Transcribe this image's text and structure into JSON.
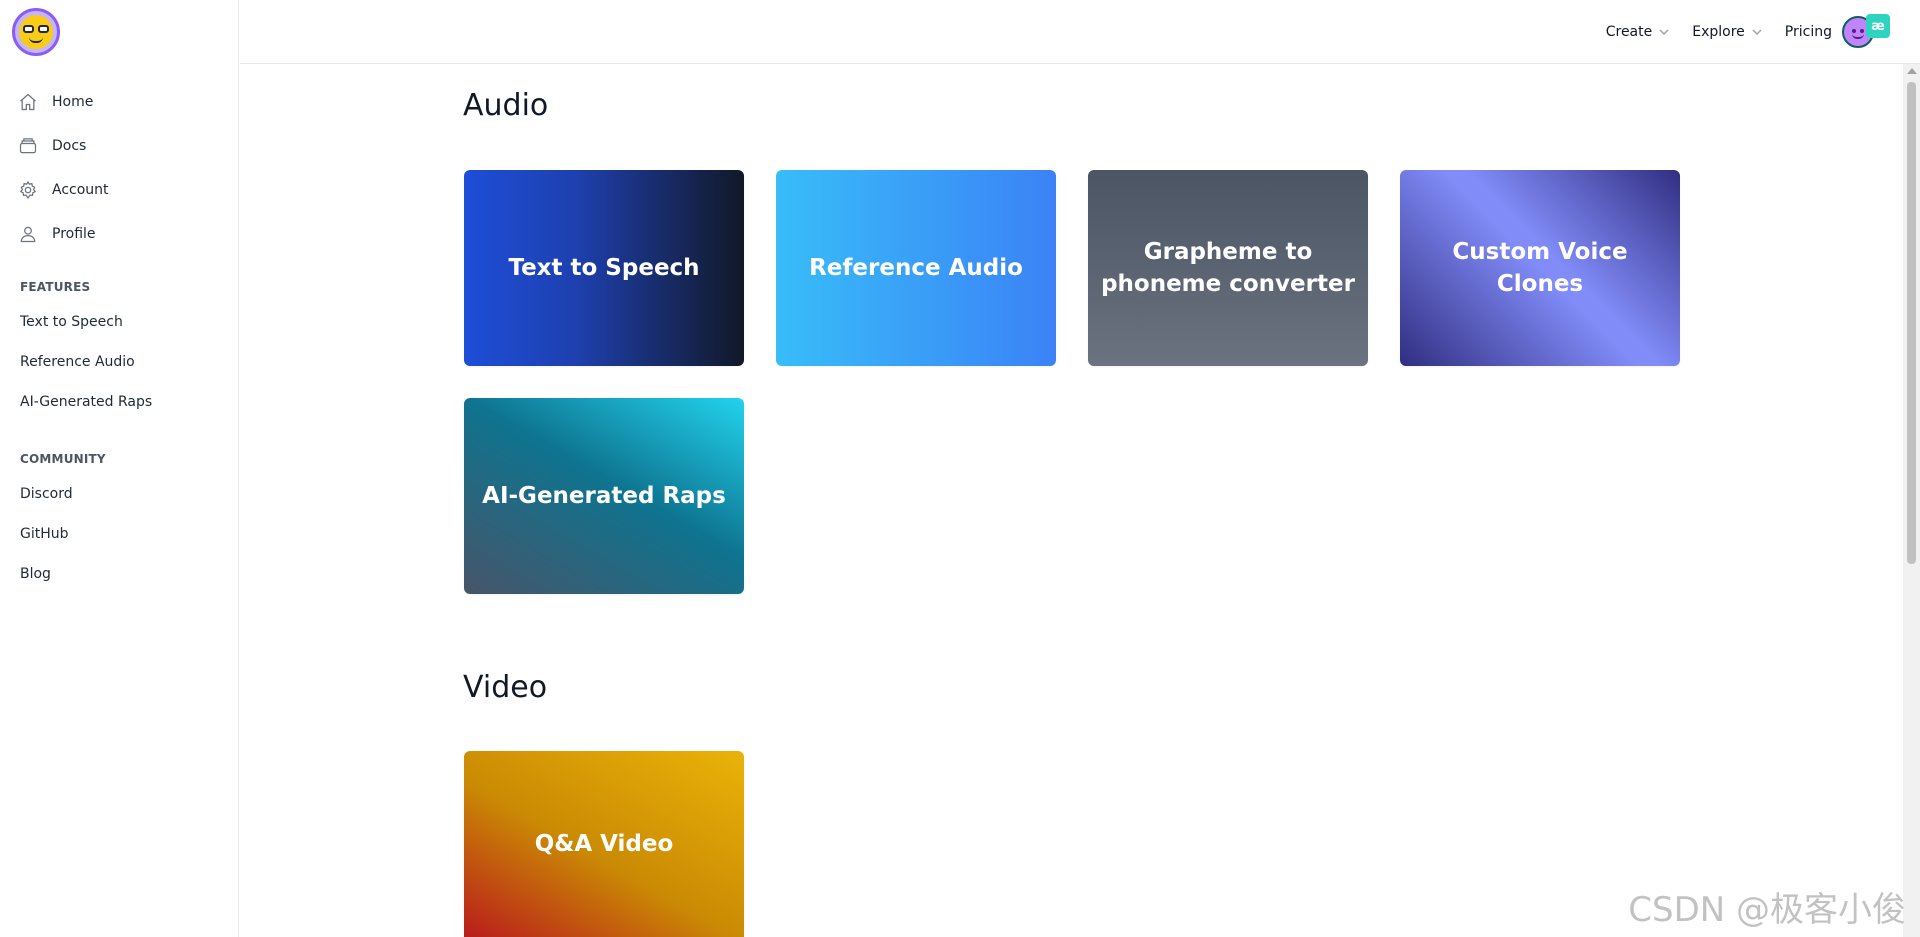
{
  "sidebar": {
    "main_items": [
      {
        "label": "Home",
        "icon": "home-icon"
      },
      {
        "label": "Docs",
        "icon": "docs-icon"
      },
      {
        "label": "Account",
        "icon": "gear-icon"
      },
      {
        "label": "Profile",
        "icon": "user-icon"
      }
    ],
    "features_title": "FEATURES",
    "features": [
      "Text to Speech",
      "Reference Audio",
      "AI-Generated Raps"
    ],
    "community_title": "COMMUNITY",
    "community": [
      "Discord",
      "GitHub",
      "Blog"
    ]
  },
  "header": {
    "create_label": "Create",
    "explore_label": "Explore",
    "pricing_label": "Pricing",
    "avatar_badge": "æ"
  },
  "main": {
    "audio_heading": "Audio",
    "audio_cards": [
      "Text to Speech",
      "Reference Audio",
      "Grapheme to phoneme converter",
      "Custom Voice Clones",
      "AI-Generated Raps"
    ],
    "video_heading": "Video",
    "video_cards": [
      "Q&A Video"
    ]
  },
  "watermark": "CSDN @极客小俊",
  "colors": {
    "border": "#e5e7eb",
    "text": "#111827",
    "muted": "#6b7280"
  }
}
